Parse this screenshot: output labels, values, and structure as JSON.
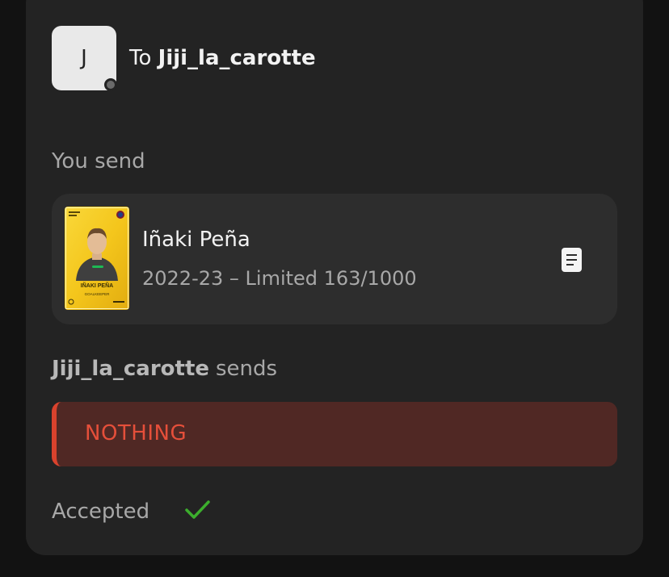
{
  "recipient": {
    "avatar_letter": "J",
    "to_prefix": "To",
    "username": "Jiji_la_carotte"
  },
  "you_send": {
    "label": "You send",
    "card": {
      "player_name": "Iñaki Peña",
      "details": "2022-23 – Limited 163/1000",
      "card_text_name": "IÑAKI PEÑA",
      "card_text_position": "GOALKEEPER",
      "card_sponsor": "Spotify",
      "card_color": "#f4c61c",
      "doc_icon": "document-icon"
    }
  },
  "they_send": {
    "username": "Jiji_la_carotte",
    "verb": "sends",
    "nothing_label": "NOTHING",
    "accent_color": "#d9422d"
  },
  "status": {
    "label": "Accepted",
    "icon": "check-icon",
    "color": "#3cae2d"
  }
}
